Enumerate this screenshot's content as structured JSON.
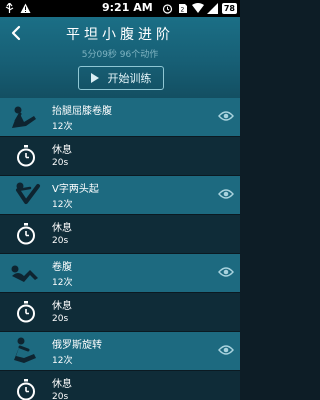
{
  "status_bar": {
    "time": "9:21 AM",
    "battery": "78"
  },
  "header": {
    "title": "平坦小腹进阶",
    "subtitle": "5分09秒  96个动作",
    "start_label": "开始训练"
  },
  "list": [
    {
      "kind": "exercise",
      "name": "抬腿屈膝卷腹",
      "detail": "12次",
      "figure": "situp-icon"
    },
    {
      "kind": "rest",
      "name": "休息",
      "detail": "20s"
    },
    {
      "kind": "exercise",
      "name": "V字两头起",
      "detail": "12次",
      "figure": "v-up-icon"
    },
    {
      "kind": "rest",
      "name": "休息",
      "detail": "20s"
    },
    {
      "kind": "exercise",
      "name": "卷腹",
      "detail": "12次",
      "figure": "crunch-icon"
    },
    {
      "kind": "rest",
      "name": "休息",
      "detail": "20s"
    },
    {
      "kind": "exercise",
      "name": "俄罗斯旋转",
      "detail": "12次",
      "figure": "russian-twist-icon"
    },
    {
      "kind": "rest",
      "name": "休息",
      "detail": "20s"
    }
  ],
  "colors": {
    "header_bg": "#1b6f86",
    "exercise_row_bg": "#1d6a80",
    "rest_row_bg": "#0f2c38"
  }
}
